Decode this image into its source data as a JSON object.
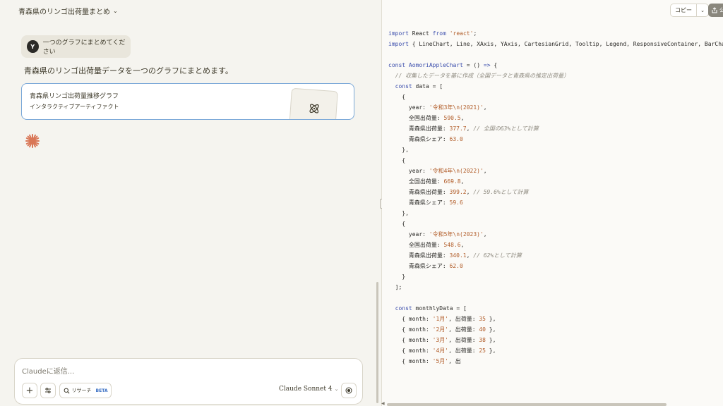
{
  "chat": {
    "title": "青森県のリンゴ出荷量まとめ",
    "user_avatar": "Y",
    "user_message": "一つのグラフにまとめてください",
    "assistant_message": "青森県のリンゴ出荷量データを一つのグラフにまとめます。",
    "artifact": {
      "title": "青森県リンゴ出荷量推移グラフ",
      "subtitle": "インタラクティブアーティファクト",
      "icon": "react-atom-icon"
    },
    "input": {
      "placeholder": "Claudeに返信...",
      "research_label": "リサーチ",
      "beta_label": "BETA",
      "model_label": "Claude Sonnet 4"
    }
  },
  "code_panel": {
    "copy_label": "コピー",
    "publish_label": "公",
    "lines": [
      [
        [
          "kw",
          "import"
        ],
        [
          "p",
          " React "
        ],
        [
          "kw",
          "from"
        ],
        [
          "p",
          " "
        ],
        [
          "str",
          "'react'"
        ],
        [
          "p",
          ";"
        ]
      ],
      [
        [
          "kw",
          "import"
        ],
        [
          "p",
          " { LineChart, Line, XAxis, YAxis, CartesianGrid, Tooltip, Legend, ResponsiveContainer, BarChart"
        ]
      ],
      [],
      [
        [
          "kw",
          "const"
        ],
        [
          "p",
          " "
        ],
        [
          "kw",
          "AomoriAppleChart"
        ],
        [
          "p",
          " = () "
        ],
        [
          "kw",
          "=>"
        ],
        [
          "p",
          " {"
        ]
      ],
      [
        [
          "cmt",
          "  // 収集したデータを基に作成（全国データと青森県の推定出荷量）"
        ]
      ],
      [
        [
          "p",
          "  "
        ],
        [
          "kw",
          "const"
        ],
        [
          "p",
          " data = ["
        ]
      ],
      [
        [
          "p",
          "    {"
        ]
      ],
      [
        [
          "p",
          "      year: "
        ],
        [
          "str",
          "'令和3年\\n(2021)'"
        ],
        [
          "p",
          ","
        ]
      ],
      [
        [
          "p",
          "      全国出荷量: "
        ],
        [
          "num",
          "590.5"
        ],
        [
          "p",
          ","
        ]
      ],
      [
        [
          "p",
          "      青森県出荷量: "
        ],
        [
          "num",
          "377.7"
        ],
        [
          "p",
          ", "
        ],
        [
          "cmt",
          "// 全国の63%として計算"
        ]
      ],
      [
        [
          "p",
          "      青森県シェア: "
        ],
        [
          "num",
          "63.0"
        ]
      ],
      [
        [
          "p",
          "    },"
        ]
      ],
      [
        [
          "p",
          "    {"
        ]
      ],
      [
        [
          "p",
          "      year: "
        ],
        [
          "str",
          "'令和4年\\n(2022)'"
        ],
        [
          "p",
          ","
        ]
      ],
      [
        [
          "p",
          "      全国出荷量: "
        ],
        [
          "num",
          "669.8"
        ],
        [
          "p",
          ","
        ]
      ],
      [
        [
          "p",
          "      青森県出荷量: "
        ],
        [
          "num",
          "399.2"
        ],
        [
          "p",
          ", "
        ],
        [
          "cmt",
          "// 59.6%として計算"
        ]
      ],
      [
        [
          "p",
          "      青森県シェア: "
        ],
        [
          "num",
          "59.6"
        ]
      ],
      [
        [
          "p",
          "    },"
        ]
      ],
      [
        [
          "p",
          "    {"
        ]
      ],
      [
        [
          "p",
          "      year: "
        ],
        [
          "str",
          "'令和5年\\n(2023)'"
        ],
        [
          "p",
          ","
        ]
      ],
      [
        [
          "p",
          "      全国出荷量: "
        ],
        [
          "num",
          "548.6"
        ],
        [
          "p",
          ","
        ]
      ],
      [
        [
          "p",
          "      青森県出荷量: "
        ],
        [
          "num",
          "340.1"
        ],
        [
          "p",
          ", "
        ],
        [
          "cmt",
          "// 62%として計算"
        ]
      ],
      [
        [
          "p",
          "      青森県シェア: "
        ],
        [
          "num",
          "62.0"
        ]
      ],
      [
        [
          "p",
          "    }"
        ]
      ],
      [
        [
          "p",
          "  ];"
        ]
      ],
      [],
      [
        [
          "p",
          "  "
        ],
        [
          "kw",
          "const"
        ],
        [
          "p",
          " monthlyData = ["
        ]
      ],
      [
        [
          "p",
          "    { month: "
        ],
        [
          "str",
          "'1月'"
        ],
        [
          "p",
          ", 出荷量: "
        ],
        [
          "num",
          "35"
        ],
        [
          "p",
          " },"
        ]
      ],
      [
        [
          "p",
          "    { month: "
        ],
        [
          "str",
          "'2月'"
        ],
        [
          "p",
          ", 出荷量: "
        ],
        [
          "num",
          "40"
        ],
        [
          "p",
          " },"
        ]
      ],
      [
        [
          "p",
          "    { month: "
        ],
        [
          "str",
          "'3月'"
        ],
        [
          "p",
          ", 出荷量: "
        ],
        [
          "num",
          "38"
        ],
        [
          "p",
          " },"
        ]
      ],
      [
        [
          "p",
          "    { month: "
        ],
        [
          "str",
          "'4月'"
        ],
        [
          "p",
          ", 出荷量: "
        ],
        [
          "num",
          "25"
        ],
        [
          "p",
          " },"
        ]
      ],
      [
        [
          "p",
          "    { month: "
        ],
        [
          "str",
          "'5月'"
        ],
        [
          "p",
          ", 出"
        ]
      ]
    ]
  }
}
